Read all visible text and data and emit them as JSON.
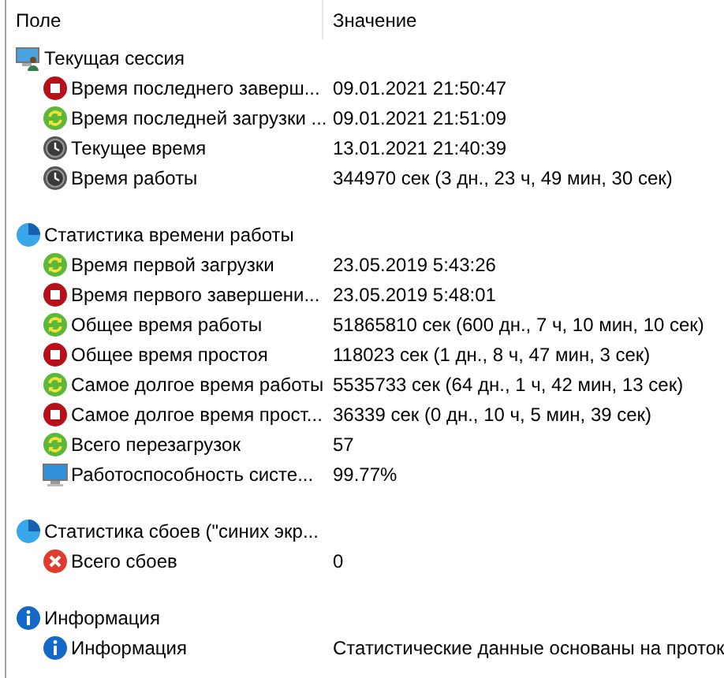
{
  "columns": [
    "Поле",
    "Значение"
  ],
  "groups": [
    {
      "kind": "session",
      "label": "Текущая сессия",
      "items": [
        {
          "kind": "stop",
          "label": "Время последнего заверш...",
          "value": "09.01.2021 21:50:47"
        },
        {
          "kind": "boot",
          "label": "Время последней загрузки ...",
          "value": "09.01.2021 21:51:09"
        },
        {
          "kind": "time",
          "label": "Текущее время",
          "value": "13.01.2021 21:40:39"
        },
        {
          "kind": "time",
          "label": "Время работы",
          "value": "344970 сек (3 дн., 23 ч, 49 мин, 30 сек)"
        }
      ]
    },
    {
      "kind": "stats",
      "label": "Статистика времени работы",
      "items": [
        {
          "kind": "boot",
          "label": "Время первой загрузки",
          "value": "23.05.2019 5:43:26"
        },
        {
          "kind": "stop",
          "label": "Время первого завершени...",
          "value": "23.05.2019 5:48:01"
        },
        {
          "kind": "boot",
          "label": "Общее время работы",
          "value": "51865810 сек (600 дн., 7 ч, 10 мин, 10 сек)"
        },
        {
          "kind": "stop",
          "label": "Общее время простоя",
          "value": "118023 сек (1 дн., 8 ч, 47 мин, 3 сек)"
        },
        {
          "kind": "boot",
          "label": "Самое долгое время работы",
          "value": "5535733 сек (64 дн., 1 ч, 42 мин, 13 сек)"
        },
        {
          "kind": "stop",
          "label": "Самое долгое время прост...",
          "value": "36339 сек (0 дн., 10 ч, 5 мин, 39 сек)"
        },
        {
          "kind": "boot",
          "label": "Всего перезагрузок",
          "value": "57"
        },
        {
          "kind": "system",
          "label": "Работоспособность систе...",
          "value": "99.77%"
        }
      ]
    },
    {
      "kind": "stats",
      "label": "Статистика сбоев (\"синих экр...",
      "items": [
        {
          "kind": "failure",
          "label": "Всего сбоев",
          "value": "0"
        }
      ]
    },
    {
      "kind": "info",
      "label": "Информация",
      "items": [
        {
          "kind": "info",
          "label": "Информация",
          "value": "Статистические данные основаны на проток"
        }
      ]
    }
  ]
}
